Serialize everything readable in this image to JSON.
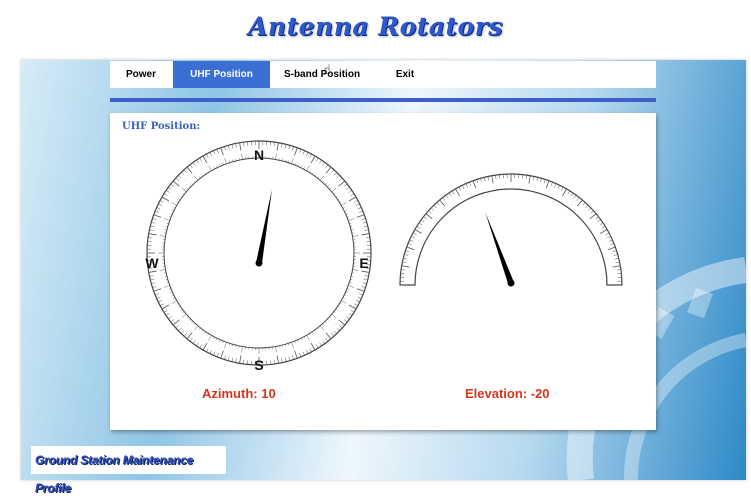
{
  "app": {
    "title": "Antenna Rotators"
  },
  "nav": {
    "tabs": [
      {
        "label": "Power",
        "active": false
      },
      {
        "label": "UHF Position",
        "active": true
      },
      {
        "label": "S-band Position",
        "active": false
      },
      {
        "label": "Exit",
        "active": false
      }
    ]
  },
  "panel": {
    "title": "UHF Position:"
  },
  "azimuth": {
    "value": 10,
    "readout": "Azimuth: 10",
    "cardinals": {
      "n": "N",
      "e": "E",
      "s": "S",
      "w": "W"
    }
  },
  "elevation": {
    "value": -20,
    "readout": "Elevation: -20"
  },
  "footer": {
    "label": "Ground Station Maintenance Profile"
  },
  "colors": {
    "accent": "#3b6fd3",
    "readout": "#d7351f",
    "title": "#2f58c8"
  },
  "icons": {
    "cursor": "hand-pointer-icon"
  }
}
